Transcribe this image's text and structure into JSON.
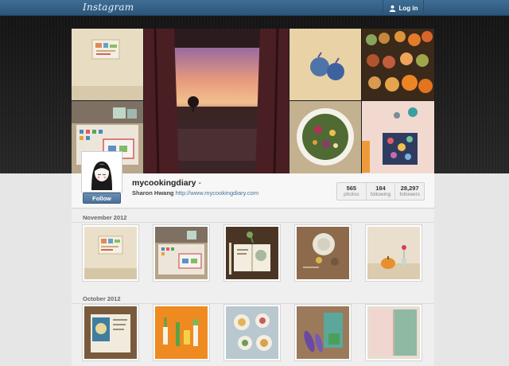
{
  "header": {
    "logo": "Instagram",
    "login_label": "Log in"
  },
  "cover": {
    "tiles": [
      "postcard-on-wall",
      "sunset-window",
      "figs-on-table",
      "market-produce",
      "desk-with-tins",
      "salad-bowl",
      "craft-table"
    ]
  },
  "profile": {
    "username": "mycookingdiary",
    "username_suffix": " -",
    "full_name": "Sharon Hwang",
    "website": "http://www.mycookingdiary.com",
    "follow_label": "Follow",
    "stats": [
      {
        "value": "565",
        "label": "photos"
      },
      {
        "value": "184",
        "label": "following"
      },
      {
        "value": "28,297",
        "label": "followers"
      }
    ]
  },
  "feed": {
    "months": [
      {
        "label": "November 2012",
        "photos": [
          "postcard-on-wall",
          "desk-with-tins",
          "open-notebook",
          "bowl-and-plates",
          "pumpkin-vase"
        ]
      },
      {
        "label": "October 2012",
        "photos": [
          "recipe-book",
          "vegetable-illustration",
          "plates-on-tablecloth",
          "vegetables-and-book",
          "green-notebook"
        ]
      }
    ]
  },
  "colors": {
    "nav_bar": "#3a658c",
    "link": "#3f729b",
    "follow_button": "#567ea6",
    "page_background": "#e6e6e6"
  }
}
